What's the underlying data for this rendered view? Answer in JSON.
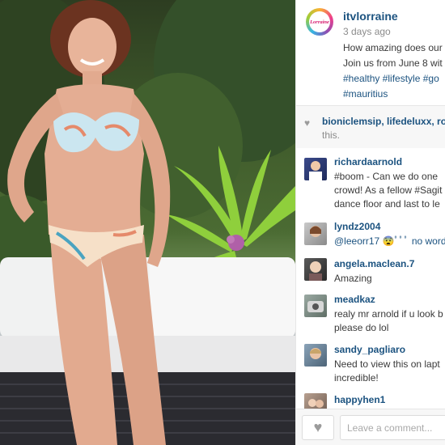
{
  "photo": {
    "alt_icon": "bikini-photo"
  },
  "post": {
    "username": "itvlorraine",
    "avatar_logo_text": "Lorraine",
    "timestamp": "3 days ago",
    "caption_lines": [
      "How amazing does our",
      "Join us from June 8 wit",
      "#healthy #lifestyle #go",
      "#mauritius"
    ]
  },
  "likes": {
    "names": "bioniclemsip, lifedeluxx, ro",
    "suffix": "this."
  },
  "comments": [
    {
      "user": "richardaarnold",
      "lines": [
        "#boom - Can we do one",
        "crowd! As a fellow #Sagit",
        "dance floor and last to le"
      ]
    },
    {
      "user": "lyndz2004",
      "lines": [
        "@leeorr17 😨ﾟﾟﾟ no word"
      ]
    },
    {
      "user": "angela.maclean.7",
      "lines": [
        "Amazing"
      ]
    },
    {
      "user": "meadkaz",
      "lines": [
        "realy mr arnold if u look b",
        "please do lol"
      ]
    },
    {
      "user": "sandy_pagliaro",
      "lines": [
        "Need to view this on lapt",
        "incredible!"
      ]
    },
    {
      "user": "happyhen1",
      "lines": []
    }
  ],
  "footer": {
    "comment_placeholder": "Leave a comment..."
  },
  "colors": {
    "link": "#1c5380",
    "text": "#3a3a3a",
    "muted": "#8b8b8b"
  }
}
